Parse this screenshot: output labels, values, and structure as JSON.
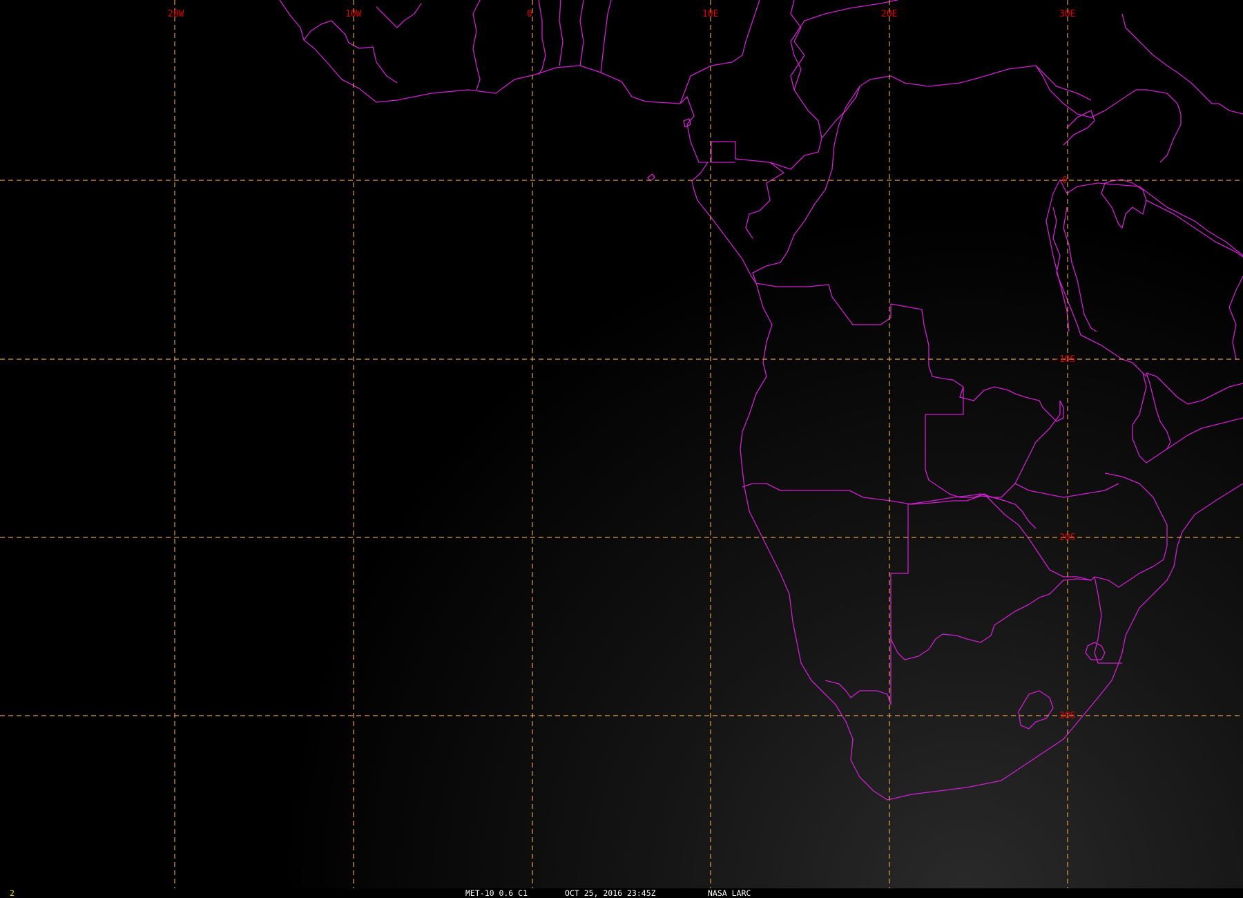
{
  "colors": {
    "background": "#000000",
    "graticule": "#e0a050",
    "grid_label": "#e00000",
    "boundary": "#d020d0",
    "status_text": "#ffffff",
    "frame_number": "#e8e000"
  },
  "graticule": {
    "longitude_labels": [
      "20W",
      "10W",
      "0",
      "10E",
      "20E",
      "30E"
    ],
    "latitude_labels": [
      "0",
      "-10S",
      "20S",
      "30S"
    ]
  },
  "status_bar": {
    "frame_number": "2",
    "satellite": "MET-10 0.6 C1",
    "datetime": "OCT 25, 2016 23:45Z",
    "source": "NASA LARC"
  }
}
